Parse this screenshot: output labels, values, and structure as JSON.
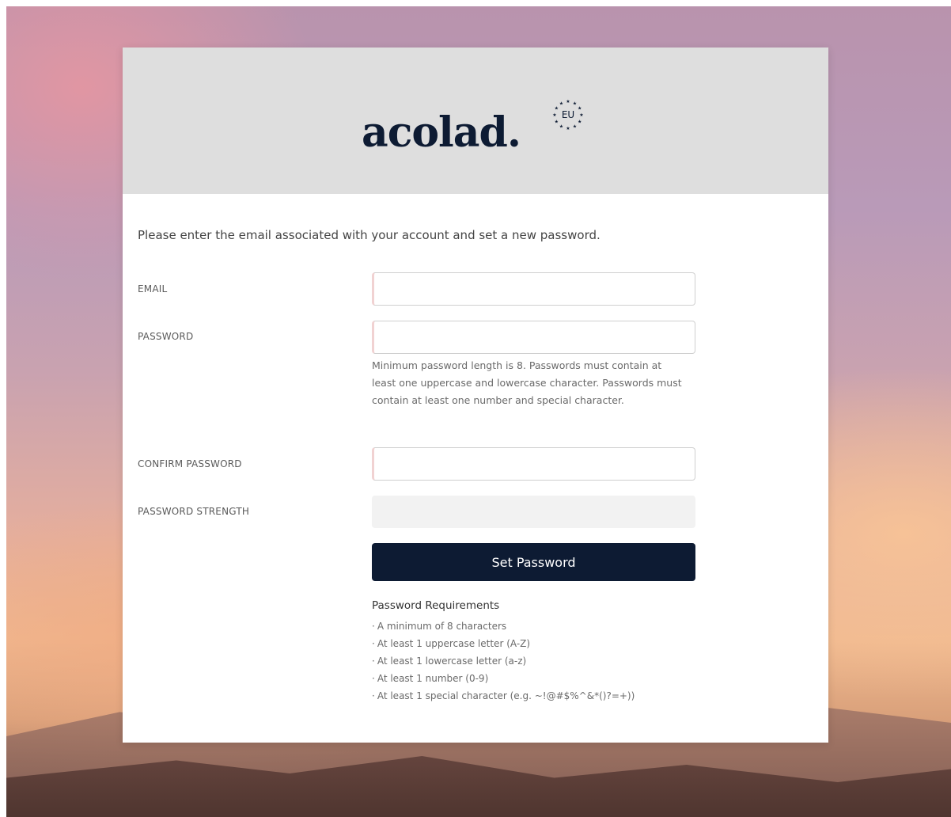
{
  "brand": {
    "logo_text": "acolad.",
    "badge_text": "EU"
  },
  "form": {
    "intro": "Please enter the email associated with your account and set a new password.",
    "email": {
      "label": "EMAIL",
      "value": "",
      "placeholder": ""
    },
    "password": {
      "label": "PASSWORD",
      "value": "",
      "placeholder": "",
      "hint": "Minimum password length is 8. Passwords must contain at least one uppercase and lowercase character. Passwords must contain at least one number and special character."
    },
    "confirm_password": {
      "label": "CONFIRM PASSWORD",
      "value": "",
      "placeholder": ""
    },
    "strength": {
      "label": "PASSWORD STRENGTH",
      "level": 0
    },
    "submit_label": "Set Password"
  },
  "requirements": {
    "title": "Password Requirements",
    "bullet": "·",
    "items": [
      "A minimum of 8 characters",
      "At least 1 uppercase letter (A-Z)",
      "At least 1 lowercase letter (a-z)",
      "At least 1 number (0-9)",
      "At least 1 special character (e.g. ~!@#$%^&*()?=+))"
    ]
  },
  "colors": {
    "primary": "#0d1b33",
    "header_bg": "#dedede",
    "input_accent": "#f1d2d2",
    "strength_bg": "#f2f2f2"
  }
}
